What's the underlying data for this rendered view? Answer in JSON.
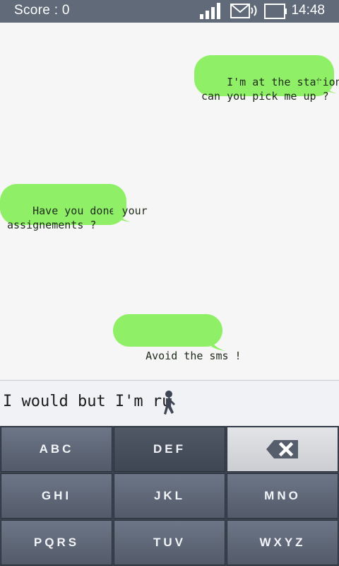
{
  "status_bar": {
    "score_label": "Score : 0",
    "time": "14:48",
    "icons": [
      "signal-icon",
      "message-icon",
      "battery-icon"
    ]
  },
  "messages": [
    {
      "side": "right",
      "text": "I'm at the station,\ncan you pick me up ?"
    },
    {
      "side": "left",
      "text": "Have you done your\nassignements ?"
    },
    {
      "side": "right",
      "text": "Avoid the sms !"
    }
  ],
  "input": {
    "typed_text": "I would but I'm ru",
    "runner_icon": "runner-icon"
  },
  "keyboard": {
    "keys": [
      "ABC",
      "DEF",
      "",
      "GHI",
      "JKL",
      "MNO",
      "PQRS",
      "TUV",
      "WXYZ"
    ],
    "delete_icon": "backspace-icon",
    "pressed_key": "DEF"
  },
  "colors": {
    "bubble": "#8ff067",
    "status_bar": "#606a78",
    "keyboard_key": "#5f6878"
  }
}
